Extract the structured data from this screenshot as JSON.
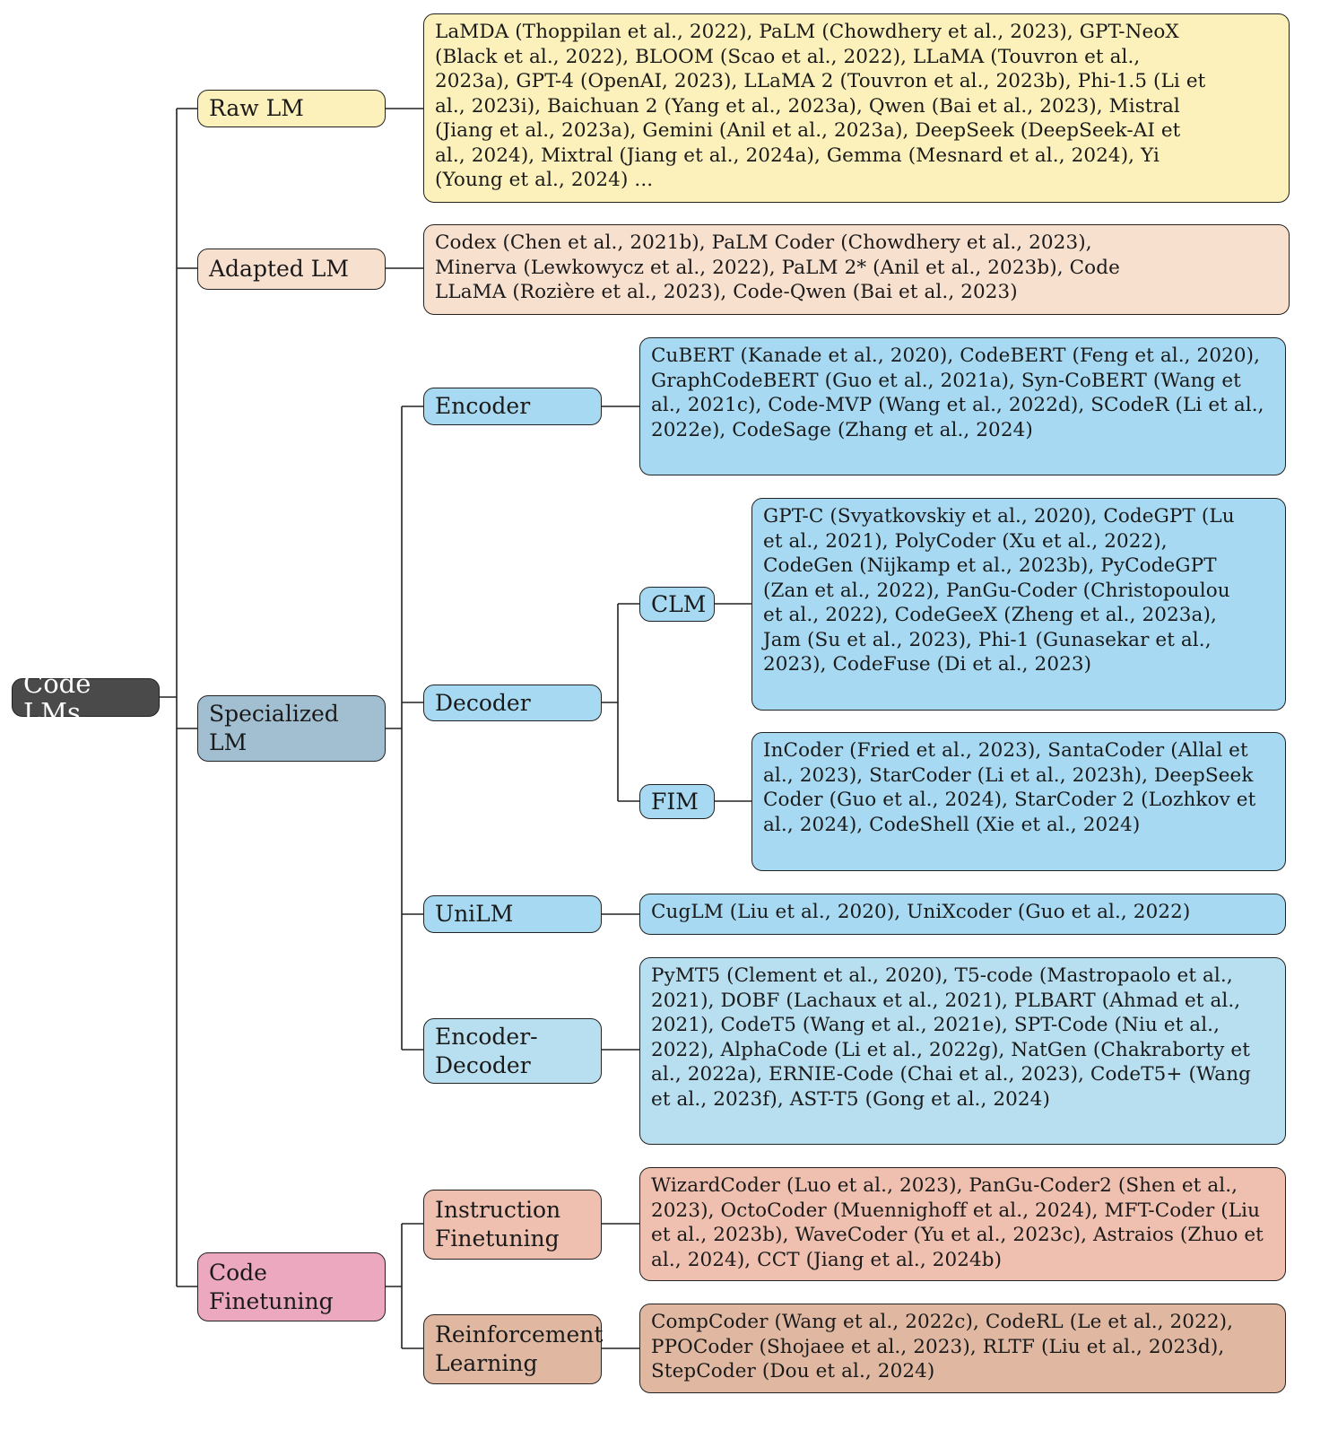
{
  "root": {
    "label": "Code LMs"
  },
  "colors": {
    "root": "#4a4a4a",
    "raw_lm": "#fcf1ba",
    "adapted_lm": "#f8e0cf",
    "specialized_lm": "#a2bfd1",
    "specialized_children": "#a7daf2",
    "encoder_decoder": "#b8dff0",
    "code_finetuning": "#eba8bf",
    "instruction_finetuning": "#efc0b0",
    "reinforcement_learning": "#e0b8a2"
  },
  "raw_lm": {
    "label": "Raw LM",
    "models": "LaMDA (Thoppilan et al., 2022), PaLM (Chowdhery et al., 2023), GPT-NeoX (Black et al., 2022), BLOOM (Scao et al., 2022), LLaMA (Touvron et al., 2023a), GPT-4 (OpenAI, 2023), LLaMA 2 (Touvron et al., 2023b), Phi-1.5 (Li et al., 2023i), Baichuan 2 (Yang et al., 2023a), Qwen (Bai et al., 2023), Mistral (Jiang et al., 2023a), Gemini (Anil et al., 2023a), DeepSeek (DeepSeek-AI et al., 2024), Mixtral (Jiang et al., 2024a), Gemma (Mesnard et al., 2024), Yi (Young et al., 2024) ..."
  },
  "adapted_lm": {
    "label": "Adapted LM",
    "models": "Codex (Chen et al., 2021b), PaLM Coder (Chowdhery et al., 2023), Minerva (Lewkowycz et al., 2022), PaLM 2* (Anil et al., 2023b), Code LLaMA (Rozière et al., 2023), Code-Qwen (Bai et al., 2023)"
  },
  "specialized_lm": {
    "label": "Specialized LM",
    "encoder": {
      "label": "Encoder",
      "models": "CuBERT (Kanade et al., 2020), CodeBERT (Feng et al., 2020), GraphCodeBERT (Guo et al., 2021a), Syn-CoBERT (Wang et al., 2021c), Code-MVP (Wang et al., 2022d), SCodeR (Li et al., 2022e), CodeSage (Zhang et al., 2024)"
    },
    "decoder": {
      "label": "Decoder",
      "clm": {
        "label": "CLM",
        "models": "GPT-C (Svyatkovskiy et al., 2020), CodeGPT (Lu et al., 2021), PolyCoder (Xu et al., 2022), CodeGen (Nijkamp et al., 2023b), PyCodeGPT (Zan et al., 2022), PanGu-Coder (Christopoulou et al., 2022), CodeGeeX (Zheng et al., 2023a), Jam (Su et al., 2023), Phi-1 (Gunasekar et al., 2023), CodeFuse (Di et al., 2023)"
      },
      "fim": {
        "label": "FIM",
        "models": "InCoder (Fried et al., 2023), SantaCoder (Allal et al., 2023), StarCoder (Li et al., 2023h), DeepSeek Coder (Guo et al., 2024), StarCoder 2 (Lozhkov et al., 2024), CodeShell (Xie et al., 2024)"
      }
    },
    "unilm": {
      "label": "UniLM",
      "models": "CugLM (Liu et al., 2020), UniXcoder (Guo et al., 2022)"
    },
    "encoder_decoder": {
      "label": "Encoder-Decoder",
      "models": "PyMT5 (Clement et al., 2020), T5-code (Mastropaolo et al., 2021), DOBF (Lachaux et al., 2021), PLBART (Ahmad et al., 2021), CodeT5 (Wang et al., 2021e), SPT-Code (Niu et al., 2022), AlphaCode (Li et al., 2022g), NatGen (Chakraborty et al., 2022a), ERNIE-Code (Chai et al., 2023), CodeT5+ (Wang et al., 2023f), AST-T5 (Gong et al., 2024)"
    }
  },
  "code_finetuning": {
    "label": "Code Finetuning",
    "instruction_finetuning": {
      "label": "Instruction Finetuning",
      "models": "WizardCoder (Luo et al., 2023), PanGu-Coder2 (Shen et al., 2023), OctoCoder (Muennighoff et al., 2024), MFT-Coder (Liu et al., 2023b), WaveCoder (Yu et al., 2023c), Astraios (Zhuo et al., 2024), CCT (Jiang et al., 2024b)"
    },
    "reinforcement_learning": {
      "label": "Reinforcement Learning",
      "models": "CompCoder (Wang et al., 2022c), CodeRL (Le et al., 2022), PPOCoder (Shojaee et al., 2023), RLTF (Liu et al., 2023d), StepCoder (Dou et al., 2024)"
    }
  }
}
